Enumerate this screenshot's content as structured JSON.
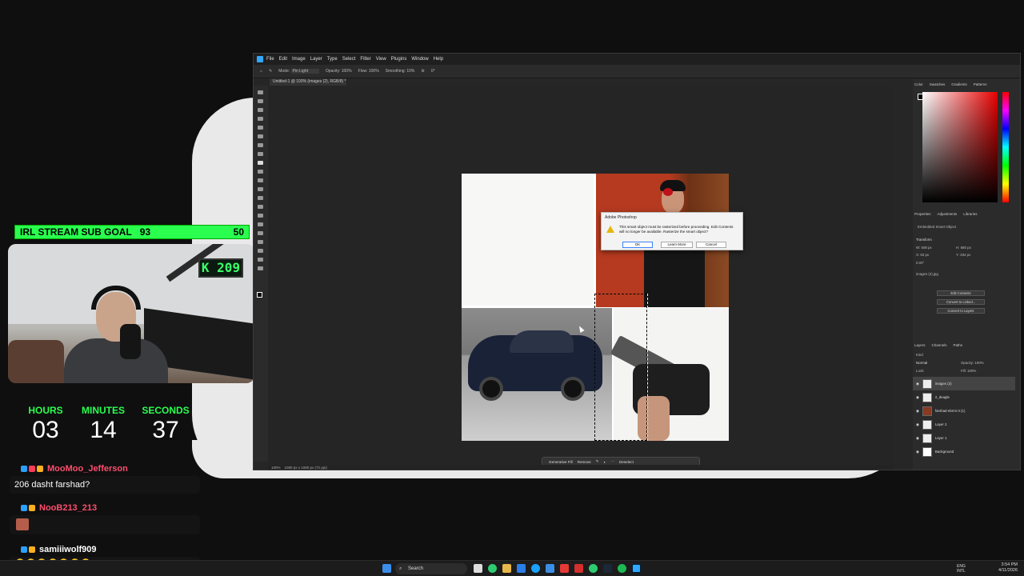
{
  "overlay": {
    "subgoal": {
      "label": "IRL STREAM SUB GOAL",
      "current": "93",
      "target": "50"
    },
    "cam_display": "K 209",
    "timer": {
      "hours_label": "HOURS",
      "hours": "03",
      "minutes_label": "MINUTES",
      "minutes": "14",
      "seconds_label": "SECONDS",
      "seconds": "37"
    },
    "chat": [
      {
        "user": "MooMoo_Jefferson",
        "color": "#ff4d6d",
        "message": "206 dasht farshad?"
      },
      {
        "user": "NooB213_213",
        "color": "#ff4d6d",
        "message": ""
      },
      {
        "user": "samiiiwolf909",
        "color": "#ffffff",
        "message": "🤣🤣🤣🤣🤣🤣🤣"
      }
    ]
  },
  "photoshop": {
    "menu": [
      "File",
      "Edit",
      "Image",
      "Layer",
      "Type",
      "Select",
      "Filter",
      "View",
      "Plugins",
      "Window",
      "Help"
    ],
    "options": {
      "mode_label": "Mode:",
      "mode_value": "Pin Light",
      "opacity_label": "Opacity:",
      "opacity": "100%",
      "flow_label": "Flow:",
      "flow": "100%",
      "smoothing_label": "Smoothing:",
      "smoothing": "10%",
      "angle": "0°"
    },
    "doc_tab": "Untitled-1 @ 100% (images (2), RGB/8) *",
    "status": {
      "zoom": "100%",
      "size": "1080 px x 1080 px (72 ppi)"
    },
    "dialog": {
      "title": "Adobe Photoshop",
      "message": "This smart object must be rasterized before proceeding. Edit Contents will no longer be available. Rasterize the smart object?",
      "ok": "OK",
      "learn_more": "Learn More",
      "cancel": "Cancel"
    },
    "context_bar": {
      "generative_fill": "Generative Fill",
      "remove": "Remove",
      "deselect": "Deselect"
    },
    "panels": {
      "color_tabs": [
        "Color",
        "Swatches",
        "Gradients",
        "Patterns"
      ],
      "props_tabs": [
        "Properties",
        "Adjustments",
        "Libraries"
      ],
      "props_type": "Embedded Smart Object",
      "transform_label": "Transform",
      "w": "W: 508 px",
      "h": "H: 680 px",
      "x": "X: 63 px",
      "y": "Y: 334 px",
      "angle": "0.00°",
      "file_label": "images (2).jpg",
      "buttons": [
        "Edit Contents",
        "Convert to Linked...",
        "Convert to Layers"
      ],
      "layers_tabs": [
        "Layers",
        "Channels",
        "Paths"
      ],
      "kind": "Kind",
      "blend": "Normal",
      "opacity_label": "Opacity:",
      "opacity": "100%",
      "lock_label": "Lock:",
      "fill_label": "Fill:",
      "fill": "100%",
      "layers": [
        "images (2)",
        "2_deagle",
        "farshad-ebrmi-3 (1)",
        "Layer 2",
        "Layer 1",
        "Background"
      ]
    }
  },
  "taskbar": {
    "search": "Search",
    "lang1": "ENG",
    "lang2": "INTL",
    "time": "3:54 PM",
    "date": "4/11/2026"
  }
}
